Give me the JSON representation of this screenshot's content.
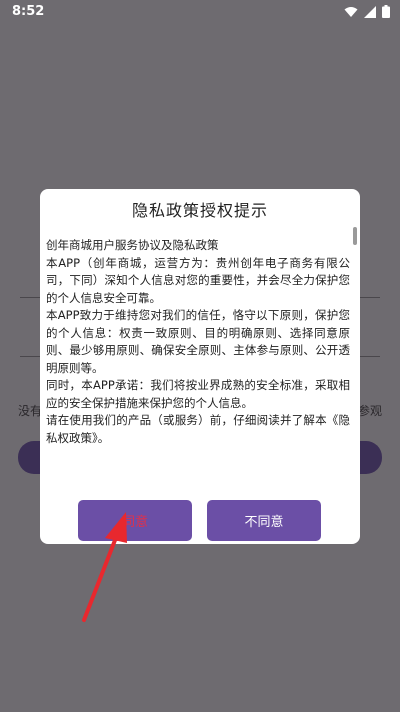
{
  "status_bar": {
    "time": "8:52",
    "icons": [
      "wifi-icon",
      "signal-icon",
      "battery-icon"
    ]
  },
  "background": {
    "left_fragment": "没有",
    "right_fragment": "参观"
  },
  "dialog": {
    "title": "隐私政策授权提示",
    "paragraphs": [
      "创年商城用户服务协议及隐私政策",
      "本APP（创年商城，运营方为：贵州创年电子商务有限公司，下同）深知个人信息对您的重要性，并会尽全力保护您的个人信息安全可靠。",
      "本APP致力于维持您对我们的信任，恪守以下原则，保护您的个人信息：权责一致原则、目的明确原则、选择同意原则、最少够用原则、确保安全原则、主体参与原则、公开透明原则等。",
      "同时，本APP承诺：我们将按业界成熟的安全标准，采取相应的安全保护措施来保护您的个人信息。",
      "请在使用我们的产品（或服务）前，仔细阅读并了解本《隐私权政策》。"
    ],
    "agree_label": "同意",
    "disagree_label": "不同意"
  },
  "colors": {
    "overlay": "#6e6b70",
    "button": "#6b4fa6",
    "agree_text": "#e0304a",
    "arrow": "#e8282e"
  }
}
